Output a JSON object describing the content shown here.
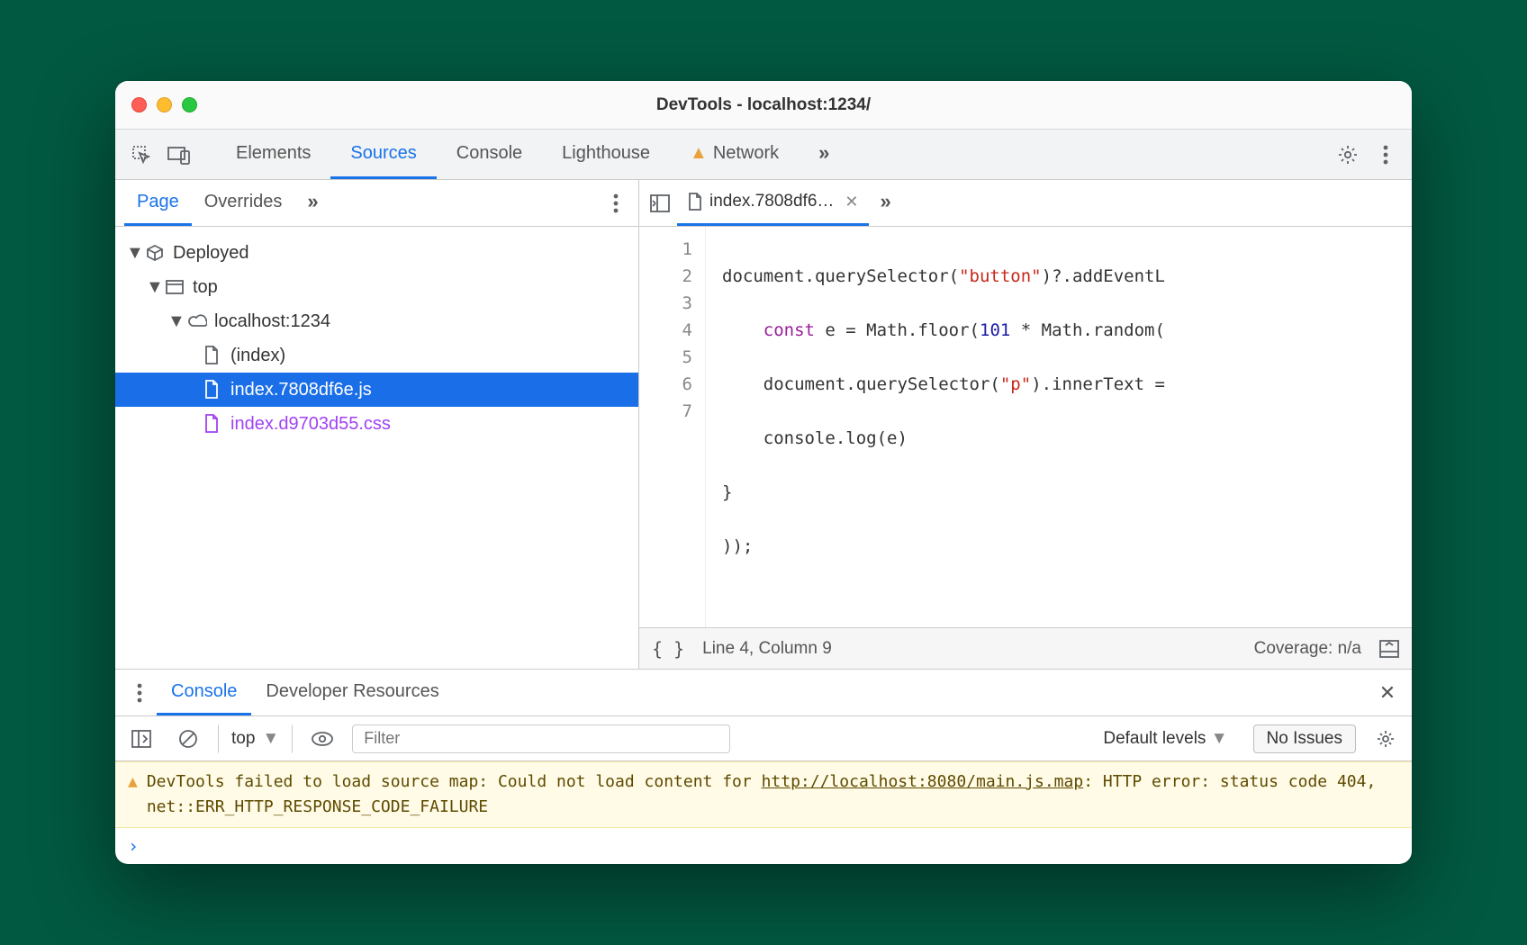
{
  "window": {
    "title": "DevTools - localhost:1234/"
  },
  "topTabs": {
    "elements": "Elements",
    "sources": "Sources",
    "console": "Console",
    "lighthouse": "Lighthouse",
    "network": "Network"
  },
  "navTabs": {
    "page": "Page",
    "overrides": "Overrides"
  },
  "tree": {
    "deployed": "Deployed",
    "top": "top",
    "origin": "localhost:1234",
    "index": "(index)",
    "jsFile": "index.7808df6e.js",
    "cssFile": "index.d9703d55.css"
  },
  "fileTab": {
    "label": "index.7808df6…"
  },
  "code": {
    "lineNumbers": [
      "1",
      "2",
      "3",
      "4",
      "5",
      "6",
      "7"
    ],
    "l1a": "document.querySelector(",
    "l1b": "\"button\"",
    "l1c": ")?.addEventL",
    "l2a": "    ",
    "l2kw": "const",
    "l2b": " e = Math.floor(",
    "l2num": "101",
    "l2c": " * Math.random(",
    "l3a": "    document.querySelector(",
    "l3str": "\"p\"",
    "l3b": ").innerText =",
    "l4": "    console.log(e)",
    "l5": "}",
    "l6": "));",
    "l7": ""
  },
  "status": {
    "cursor": "Line 4, Column 9",
    "coverage": "Coverage: n/a"
  },
  "drawer": {
    "consoleTab": "Console",
    "devResTab": "Developer Resources",
    "context": "top",
    "filterPlaceholder": "Filter",
    "levels": "Default levels",
    "issues": "No Issues"
  },
  "warning": {
    "textA": "DevTools failed to load source map: Could not load content for ",
    "link": "http://localhost:8080/main.js.map",
    "textB": ": HTTP error: status code 404, net::ERR_HTTP_RESPONSE_CODE_FAILURE"
  },
  "prompt": "›"
}
